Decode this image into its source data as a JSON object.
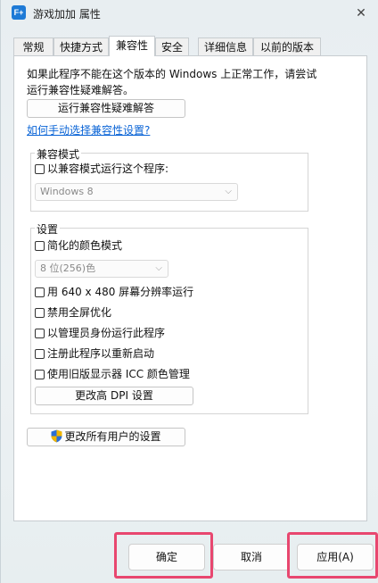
{
  "window": {
    "title": "游戏加加 属性",
    "app_icon_text": "F+"
  },
  "tabs": [
    {
      "label": "常规"
    },
    {
      "label": "快捷方式"
    },
    {
      "label": "兼容性"
    },
    {
      "label": "安全"
    },
    {
      "label": "详细信息"
    },
    {
      "label": "以前的版本"
    }
  ],
  "compat": {
    "intro_line1": "如果此程序不能在这个版本的 Windows 上正常工作，请尝试",
    "intro_line2": "运行兼容性疑难解答。",
    "troubleshoot_button": "运行兼容性疑难解答",
    "manual_link": "如何手动选择兼容性设置?",
    "mode_group_label": "兼容模式",
    "mode_checkbox": "以兼容模式运行这个程序:",
    "mode_select_value": "Windows 8",
    "settings_group_label": "设置",
    "reduced_color": "简化的颜色模式",
    "color_select_value": "8 位(256)色",
    "res_640": "用 640 x 480 屏幕分辨率运行",
    "disable_fullscreen": "禁用全屏优化",
    "run_as_admin": "以管理员身份运行此程序",
    "register_restart": "注册此程序以重新启动",
    "legacy_icc": "使用旧版显示器 ICC 颜色管理",
    "dpi_button": "更改高 DPI 设置",
    "all_users_button": "更改所有用户的设置"
  },
  "footer": {
    "ok": "确定",
    "cancel": "取消",
    "apply": "应用(A)"
  },
  "colors": {
    "highlight": "#e8476f",
    "link": "#0a64d6"
  }
}
